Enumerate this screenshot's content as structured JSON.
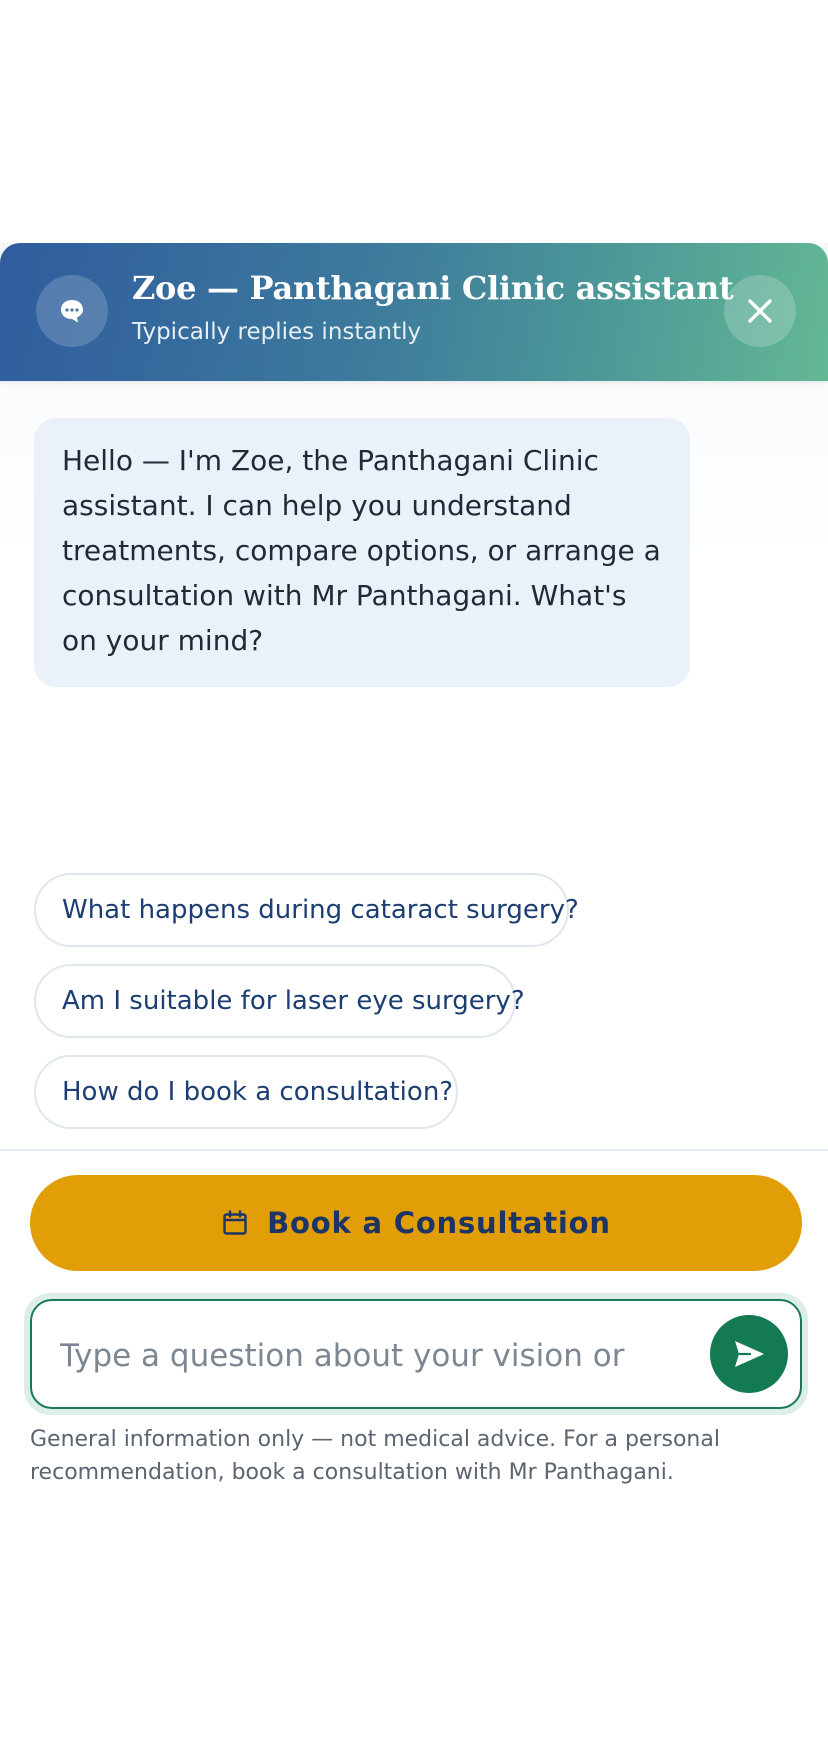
{
  "header": {
    "title": "Zoe — Panthagani Clinic assistant",
    "subtitle": "Typically replies instantly",
    "avatar_icon": "chat-bubble-icon",
    "close_icon": "close-icon"
  },
  "messages": [
    {
      "sender": "assistant",
      "text": "Hello — I'm Zoe, the Panthagani Clinic assistant. I can help you understand treatments, compare options, or arrange a consultation with Mr Panthagani. What's on your mind?"
    }
  ],
  "suggestions": [
    "What happens during cataract surgery?",
    "Am I suitable for laser eye surgery?",
    "How do I book a consultation?"
  ],
  "book_button": {
    "label": "Book a Consultation",
    "icon": "calendar-icon"
  },
  "input": {
    "placeholder": "Type a question about your vision or",
    "value": "",
    "send_icon": "send-icon"
  },
  "disclaimer": "General information only — not medical advice. For a personal recommendation, book a consultation with Mr Panthagani.",
  "colors": {
    "header_gradient_start": "#2f5c9e",
    "header_gradient_end": "#63b894",
    "book_button": "#e29e06",
    "send_button": "#137a52",
    "bubble": "#eaf1f9",
    "chip_text": "#1c3e73"
  }
}
